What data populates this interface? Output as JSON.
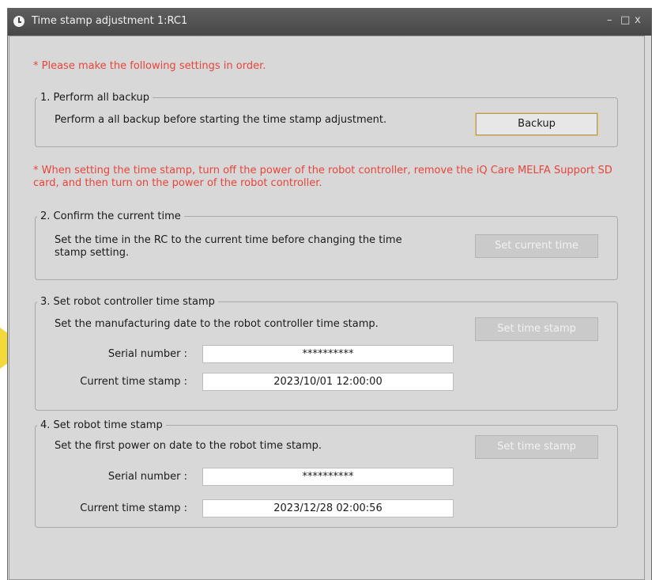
{
  "window": {
    "title": "Time stamp adjustment 1:RC1",
    "controls": {
      "minimize": "–",
      "maximize": "□",
      "close": "x"
    }
  },
  "notes": {
    "order": "* Please make the following settings in order.",
    "power": "* When setting the time stamp, turn off the power of the robot controller, remove the iQ Care MELFA Support SD card, and then turn on the power of the robot controller."
  },
  "section1": {
    "legend": "1. Perform all backup",
    "description": "Perform a all backup before starting the time stamp adjustment.",
    "button": "Backup"
  },
  "section2": {
    "legend": "2. Confirm the current time",
    "description": "Set the time in the RC to the current time before changing the time stamp setting.",
    "button": "Set current time"
  },
  "section3": {
    "legend": "3. Set robot controller time stamp",
    "description": "Set the manufacturing date to the robot controller time stamp.",
    "button": "Set time stamp",
    "serial_label": "Serial number :",
    "serial_value": "**********",
    "timestamp_label": "Current time stamp :",
    "timestamp_value": "2023/10/01 12:00:00"
  },
  "section4": {
    "legend": "4. Set robot time stamp",
    "description": "Set the first power on date to the robot time stamp.",
    "button": "Set time stamp",
    "serial_label": "Serial number :",
    "serial_value": "**********",
    "timestamp_label": "Current time stamp :",
    "timestamp_value": "2023/12/28 02:00:56"
  },
  "colors": {
    "note_red": "#e8443b",
    "highlight_arrow": "#f3d93a",
    "focus_border": "#f0c44c"
  }
}
